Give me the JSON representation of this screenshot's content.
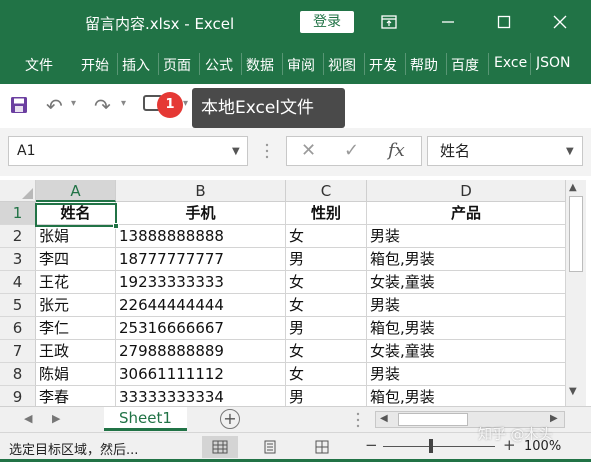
{
  "window": {
    "title": "留言内容.xlsx  -  Excel",
    "login_label": "登录",
    "icons": [
      "ribbon-display-icon",
      "minimize-icon",
      "maximize-icon",
      "close-icon"
    ]
  },
  "ribbon": {
    "tabs": [
      "文件",
      "开始",
      "插入",
      "页面",
      "公式",
      "数据",
      "审阅",
      "视图",
      "开发",
      "帮助",
      "百度",
      "Exce",
      "JSON"
    ]
  },
  "qat": {
    "badge_count": "1",
    "tooltip": "本地Excel文件"
  },
  "formula_bar": {
    "name_box": "A1",
    "cancel_symbol": "✕",
    "enter_symbol": "✓",
    "fx_symbol": "fx",
    "content": "姓名"
  },
  "grid": {
    "columns": [
      "A",
      "B",
      "C",
      "D"
    ],
    "row_numbers": [
      "1",
      "2",
      "3",
      "4",
      "5",
      "6",
      "7",
      "8",
      "9"
    ],
    "rows": [
      [
        "姓名",
        "手机",
        "性别",
        "产品"
      ],
      [
        "张娟",
        "13888888888",
        "女",
        "男装"
      ],
      [
        "李四",
        "18777777777",
        "男",
        "箱包,男装"
      ],
      [
        "王花",
        "19233333333",
        "女",
        "女装,童装"
      ],
      [
        "张元",
        "22644444444",
        "女",
        "男装"
      ],
      [
        "李仁",
        "25316666667",
        "男",
        "箱包,男装"
      ],
      [
        "王政",
        "27988888889",
        "女",
        "女装,童装"
      ],
      [
        "陈娟",
        "30661111112",
        "女",
        "男装"
      ],
      [
        "李春",
        "33333333334",
        "男",
        "箱包,男装"
      ]
    ]
  },
  "sheets": {
    "active": "Sheet1",
    "add_symbol": "+"
  },
  "status": {
    "text": "选定目标区域，然后...",
    "zoom_minus": "−",
    "zoom_plus": "+",
    "zoom": "100%"
  },
  "watermark": "知乎 @木头",
  "colors": {
    "accent": "#217346",
    "badge": "#e53935",
    "tooltip": "#4a4a4a"
  }
}
